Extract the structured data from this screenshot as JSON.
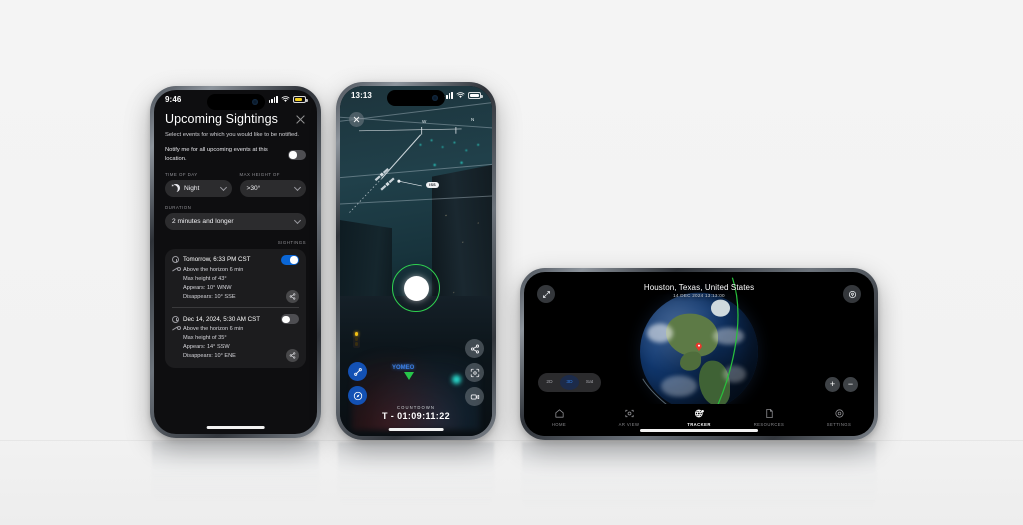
{
  "scene": {
    "background": "#f2f2f2",
    "accent_blue": "#0a66d6",
    "accent_green": "#2fd14f"
  },
  "phone1": {
    "statusbar": {
      "time": "9:46",
      "battery_state": "low",
      "signal_icon": "cellular-bars-icon",
      "wifi_icon": "wifi-icon",
      "battery_icon": "battery-low-icon"
    },
    "title": "Upcoming Sightings",
    "close_icon": "close-icon",
    "subtitle": "Select events for which you would like to be notified.",
    "notify": {
      "label": "Notify me for all upcoming events at this location.",
      "toggle_state": "off"
    },
    "filters": {
      "time_of_day": {
        "label": "TIME OF DAY",
        "value": "Night",
        "icon": "moon-icon"
      },
      "max_height": {
        "label": "MAX HEIGHT OF",
        "value": ">30°"
      },
      "duration": {
        "label": "DURATION",
        "value": "2 minutes and longer"
      }
    },
    "sightings_header": "SIGHTINGS",
    "sightings": [
      {
        "title": "Tomorrow, 6:33 PM CST",
        "toggle_state": "on",
        "clock_icon": "clock-icon",
        "satellite_icon": "satellite-icon",
        "share_icon": "share-icon",
        "details": [
          "Above the horizon 6 min",
          "Max height of 43°",
          "Appears: 10° WNW",
          "Disappears: 10° SSE"
        ]
      },
      {
        "title": "Dec 14, 2024, 5:30 AM CST",
        "toggle_state": "off",
        "clock_icon": "clock-icon",
        "satellite_icon": "satellite-icon",
        "share_icon": "share-icon",
        "details": [
          "Above the horizon 6 min",
          "Max height of 35°",
          "Appears: 14° SSW",
          "Disappears: 10° ENE"
        ]
      }
    ]
  },
  "phone2": {
    "statusbar": {
      "time": "13:13",
      "battery_state": "full",
      "signal_icon": "cellular-bars-icon",
      "wifi_icon": "wifi-icon",
      "battery_icon": "battery-full-icon"
    },
    "close_icon": "close-icon",
    "compass_label": "W",
    "compass_label_2": "N",
    "target_pill": "ISS",
    "neon_sign_text": "YOMEO",
    "countdown": {
      "label": "COUNTDOWN",
      "value": "T - 01:09:11:22"
    },
    "buttons": {
      "left": [
        {
          "name": "orbit-path-button",
          "icon": "satellite-path-icon"
        },
        {
          "name": "compass-button",
          "icon": "compass-icon"
        }
      ],
      "right": [
        {
          "name": "share-button",
          "icon": "share-icon"
        },
        {
          "name": "recenter-button",
          "icon": "focus-target-icon"
        },
        {
          "name": "record-video-button",
          "icon": "video-camera-icon"
        }
      ]
    }
  },
  "phone3": {
    "title": "Houston, Texas, United States",
    "subtitle": "14 DEC 2024 13:13:00",
    "expand_icon": "expand-arrows-icon",
    "locate_icon": "location-pin-icon",
    "view_modes": [
      {
        "label": "2D",
        "active": false
      },
      {
        "label": "3D",
        "active": true
      },
      {
        "label": "Sat",
        "active": false
      }
    ],
    "zoom_controls": [
      {
        "label": "+",
        "name": "zoom-in-button"
      },
      {
        "label": "−",
        "name": "zoom-out-button"
      }
    ],
    "tabs": [
      {
        "label": "HOME",
        "icon": "home-icon",
        "active": false
      },
      {
        "label": "AR VIEW",
        "icon": "ar-view-icon",
        "active": false
      },
      {
        "label": "TRACKER",
        "icon": "tracker-globe-icon",
        "active": true
      },
      {
        "label": "RESOURCES",
        "icon": "document-icon",
        "active": false
      },
      {
        "label": "SETTINGS",
        "icon": "gear-icon",
        "active": false
      }
    ]
  }
}
